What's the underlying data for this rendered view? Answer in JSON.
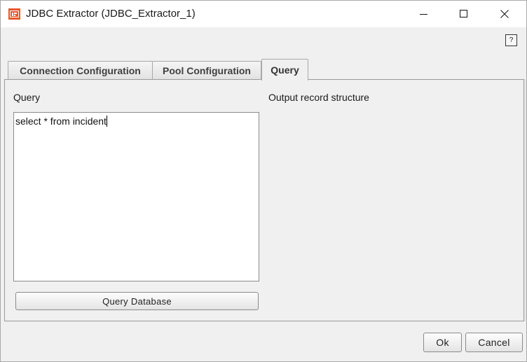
{
  "window": {
    "title": "JDBC Extractor (JDBC_Extractor_1)",
    "app_icon": "tibco-db-icon",
    "controls": [
      "minimize-icon",
      "maximize-icon",
      "close-icon"
    ]
  },
  "help": {
    "label": "?"
  },
  "tabs": [
    {
      "label": "Connection Configuration",
      "active": false
    },
    {
      "label": "Pool Configuration",
      "active": false
    },
    {
      "label": "Query",
      "active": true
    }
  ],
  "query_panel": {
    "query_label": "Query",
    "query_text": "select * from incident",
    "output_label": "Output record structure",
    "query_button": "Query Database"
  },
  "footer": {
    "ok_label": "Ok",
    "cancel_label": "Cancel"
  },
  "colors": {
    "icon_accent": "#e8562a",
    "background": "#f0f0f0"
  }
}
